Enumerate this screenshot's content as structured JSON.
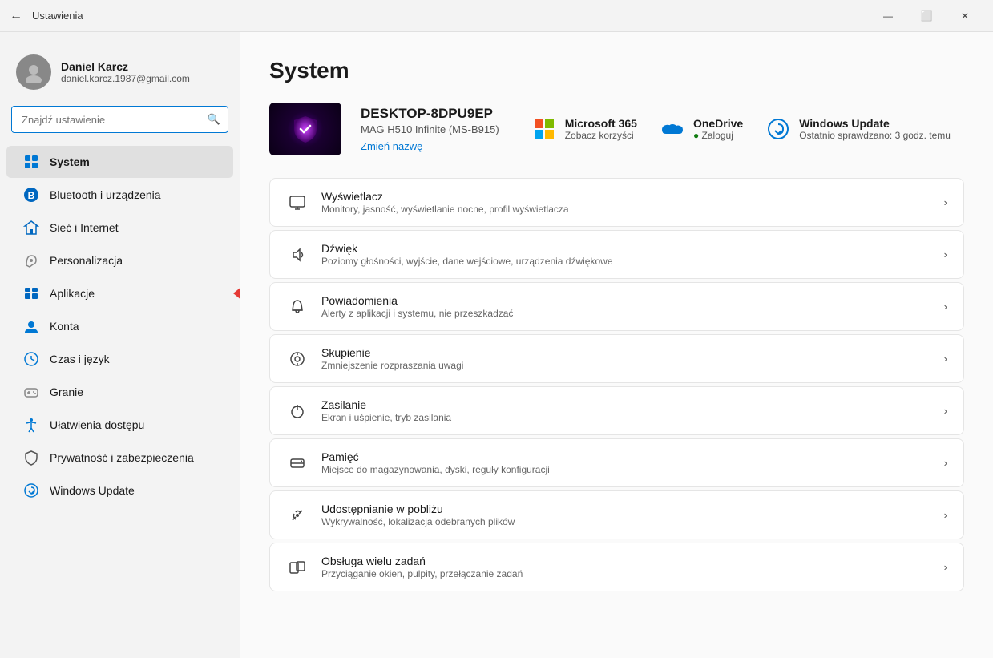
{
  "titlebar": {
    "back_icon": "←",
    "title": "Ustawienia",
    "minimize": "—",
    "maximize": "⬜",
    "close": "✕"
  },
  "sidebar": {
    "user": {
      "name": "Daniel Karcz",
      "email": "daniel.karcz.1987@gmail.com"
    },
    "search_placeholder": "Znajdź ustawienie",
    "nav_items": [
      {
        "id": "system",
        "label": "System",
        "active": true
      },
      {
        "id": "bluetooth",
        "label": "Bluetooth i urządzenia",
        "active": false
      },
      {
        "id": "network",
        "label": "Sieć i Internet",
        "active": false
      },
      {
        "id": "personalization",
        "label": "Personalizacja",
        "active": false
      },
      {
        "id": "apps",
        "label": "Aplikacje",
        "active": false,
        "has_arrow": true
      },
      {
        "id": "accounts",
        "label": "Konta",
        "active": false
      },
      {
        "id": "time",
        "label": "Czas i język",
        "active": false
      },
      {
        "id": "gaming",
        "label": "Granie",
        "active": false
      },
      {
        "id": "accessibility",
        "label": "Ułatwienia dostępu",
        "active": false
      },
      {
        "id": "privacy",
        "label": "Prywatność i zabezpieczenia",
        "active": false
      },
      {
        "id": "update",
        "label": "Windows Update",
        "active": false
      }
    ]
  },
  "main": {
    "title": "System",
    "device": {
      "name": "DESKTOP-8DPU9EP",
      "model": "MAG H510 Infinite (MS-B915)",
      "rename_label": "Zmień nazwę"
    },
    "services": [
      {
        "id": "microsoft365",
        "name": "Microsoft 365",
        "sub": "Zobacz korzyści"
      },
      {
        "id": "onedrive",
        "name": "OneDrive",
        "sub": "Zaloguj",
        "dot": true
      },
      {
        "id": "windowsupdate",
        "name": "Windows Update",
        "sub": "Ostatnio sprawdzano: 3 godz. temu"
      }
    ],
    "settings": [
      {
        "id": "display",
        "title": "Wyświetlacz",
        "desc": "Monitory, jasność, wyświetlanie nocne, profil wyświetlacza"
      },
      {
        "id": "sound",
        "title": "Dźwięk",
        "desc": "Poziomy głośności, wyjście, dane wejściowe, urządzenia dźwiękowe"
      },
      {
        "id": "notifications",
        "title": "Powiadomienia",
        "desc": "Alerty z aplikacji i systemu, nie przeszkadzać"
      },
      {
        "id": "focus",
        "title": "Skupienie",
        "desc": "Zmniejszenie rozpraszania uwagi"
      },
      {
        "id": "power",
        "title": "Zasilanie",
        "desc": "Ekran i uśpienie, tryb zasilania"
      },
      {
        "id": "storage",
        "title": "Pamięć",
        "desc": "Miejsce do magazynowania, dyski, reguły konfiguracji"
      },
      {
        "id": "nearby",
        "title": "Udostępnianie w pobliżu",
        "desc": "Wykrywalność, lokalizacja odebranych plików"
      },
      {
        "id": "multitask",
        "title": "Obsługa wielu zadań",
        "desc": "Przyciąganie okien, pulpity, przełączanie zadań"
      }
    ]
  }
}
